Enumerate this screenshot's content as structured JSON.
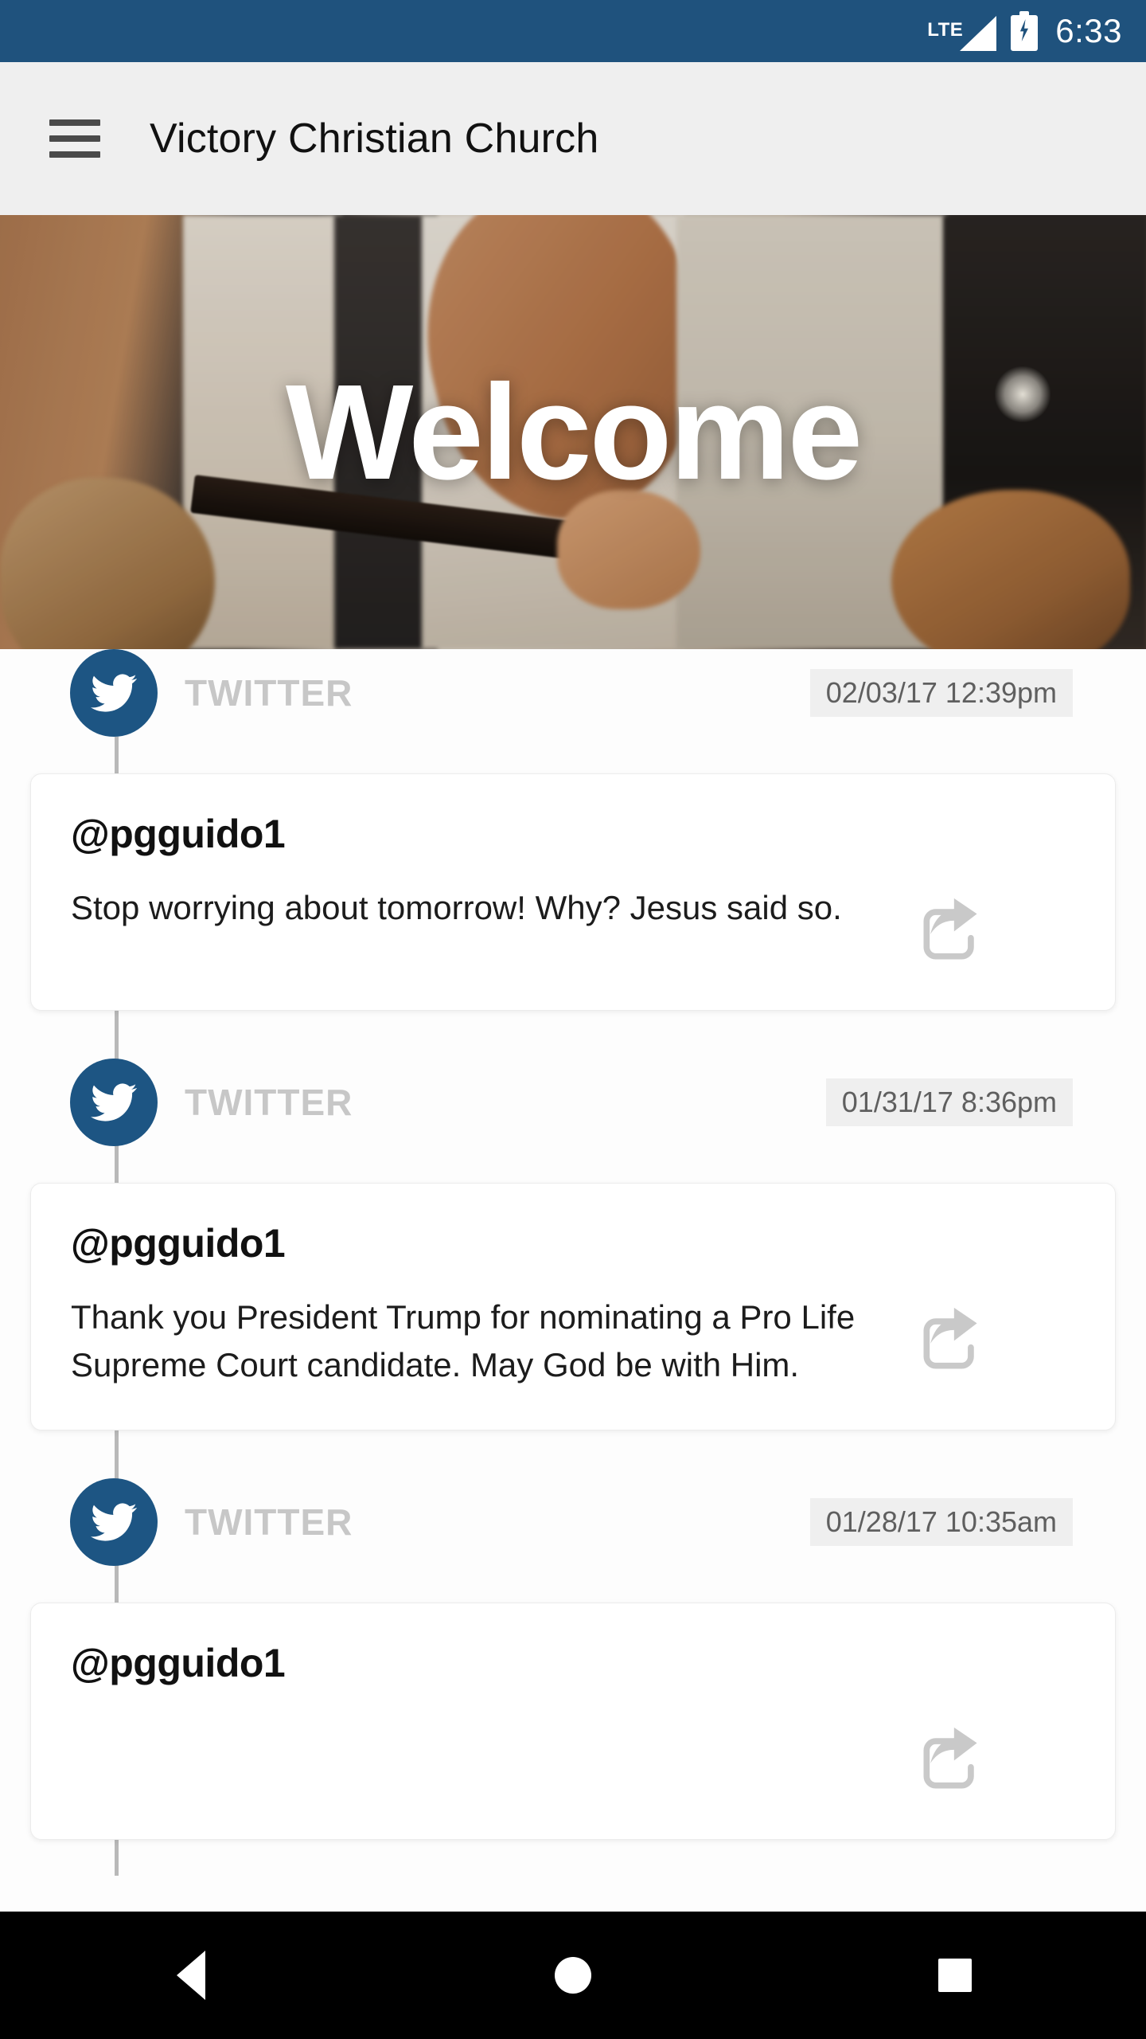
{
  "status_bar": {
    "network_label": "LTE",
    "time": "6:33",
    "battery_state": "charging",
    "background_color": "#1f527d"
  },
  "app_bar": {
    "menu_icon": "hamburger-menu-icon",
    "title": "Victory Christian Church",
    "background_color": "#efefef"
  },
  "hero": {
    "title": "Welcome",
    "description": "worship band photo with guitar and congregation"
  },
  "feed": {
    "posts": [
      {
        "source": "TWITTER",
        "source_icon": "twitter-bird-icon",
        "timestamp": "02/03/17 12:39pm",
        "username": "@pgguido1",
        "text": "Stop worrying about tomorrow! Why? Jesus said so.",
        "share_icon": "share-icon"
      },
      {
        "source": "TWITTER",
        "source_icon": "twitter-bird-icon",
        "timestamp": "01/31/17 8:36pm",
        "username": "@pgguido1",
        "text": "Thank you President Trump for nominating a Pro Life Supreme Court candidate. May God be with Him.",
        "share_icon": "share-icon"
      },
      {
        "source": "TWITTER",
        "source_icon": "twitter-bird-icon",
        "timestamp": "01/28/17 10:35am",
        "username": "@pgguido1",
        "text": "",
        "share_icon": "share-icon"
      }
    ],
    "accent_color": "#1d5583",
    "label_color": "#c7c7c7"
  },
  "nav_bar": {
    "back_label": "Back",
    "home_label": "Home",
    "recents_label": "Recents",
    "background_color": "#000000"
  }
}
